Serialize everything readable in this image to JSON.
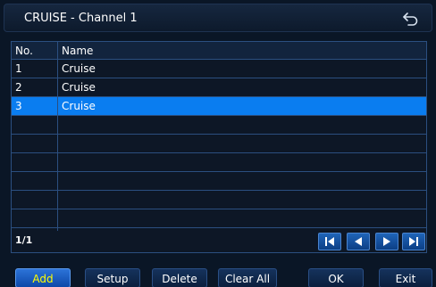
{
  "window": {
    "title": "CRUISE - Channel 1"
  },
  "table": {
    "columns": {
      "no": "No.",
      "name": "Name"
    },
    "rows": [
      {
        "no": "1",
        "name": "Cruise",
        "selected": false
      },
      {
        "no": "2",
        "name": "Cruise",
        "selected": false
      },
      {
        "no": "3",
        "name": "Cruise",
        "selected": true
      },
      {
        "no": "",
        "name": ""
      },
      {
        "no": "",
        "name": ""
      },
      {
        "no": "",
        "name": ""
      },
      {
        "no": "",
        "name": ""
      },
      {
        "no": "",
        "name": ""
      },
      {
        "no": "",
        "name": ""
      }
    ]
  },
  "pagination": {
    "indicator": "1/1",
    "icons": [
      "first-page-icon",
      "previous-page-icon",
      "next-page-icon",
      "last-page-icon"
    ]
  },
  "buttons": {
    "add": "Add",
    "setup": "Setup",
    "delete": "Delete",
    "clear_all": "Clear All",
    "ok": "OK",
    "exit": "Exit"
  },
  "icons": {
    "back": "back-arrow-icon"
  },
  "colors": {
    "background": "#0a1626",
    "selected_row": "#0a7df0",
    "grid_line": "#2b4f80",
    "active_button_text": "#ffff00"
  }
}
